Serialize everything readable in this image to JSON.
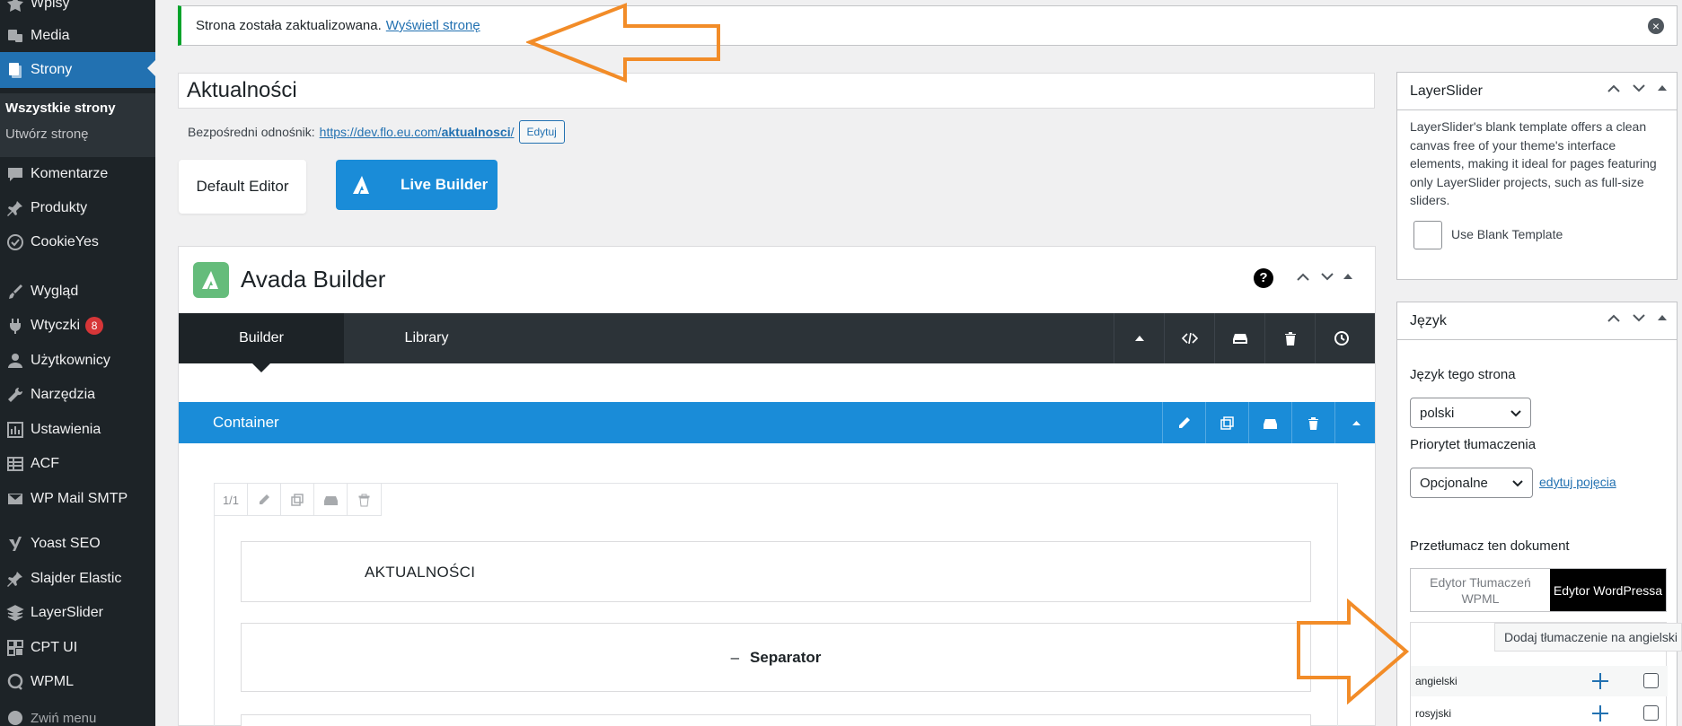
{
  "sidebar": {
    "items": [
      {
        "label": "Wpisy",
        "icon": "pin-icon"
      },
      {
        "label": "Media",
        "icon": "media-icon"
      },
      {
        "label": "Strony",
        "icon": "pages-icon"
      },
      {
        "label": "Komentarze",
        "icon": "comment-icon"
      },
      {
        "label": "Produkty",
        "icon": "pin-icon"
      },
      {
        "label": "CookieYes",
        "icon": "cookie-icon"
      },
      {
        "label": "Wygląd",
        "icon": "brush-icon"
      },
      {
        "label": "Wtyczki",
        "icon": "plugin-icon",
        "badge": "8"
      },
      {
        "label": "Użytkownicy",
        "icon": "user-icon"
      },
      {
        "label": "Narzędzia",
        "icon": "wrench-icon"
      },
      {
        "label": "Ustawienia",
        "icon": "settings-icon"
      },
      {
        "label": "ACF",
        "icon": "table-icon"
      },
      {
        "label": "WP Mail SMTP",
        "icon": "mail-icon"
      },
      {
        "label": "Yoast SEO",
        "icon": "yoast-icon"
      },
      {
        "label": "Slajder Elastic",
        "icon": "pin-icon"
      },
      {
        "label": "LayerSlider",
        "icon": "layers-icon"
      },
      {
        "label": "CPT UI",
        "icon": "grid-icon"
      },
      {
        "label": "WPML",
        "icon": "wpml-icon"
      },
      {
        "label": "Zwiń menu",
        "icon": "collapse-icon"
      }
    ],
    "submenu": [
      "Wszystkie strony",
      "Utwórz stronę"
    ]
  },
  "notice": {
    "text": "Strona została zaktualizowana.",
    "link": "Wyświetl stronę"
  },
  "editor": {
    "title": "Aktualności",
    "permalink_label": "Bezpośredni odnośnik:",
    "permalink_base": "https://dev.flo.eu.com/",
    "permalink_slug": "aktualnosci",
    "permalink_end": "/",
    "edit_label": "Edytuj",
    "default_editor": "Default Editor",
    "live_builder": "Live Builder"
  },
  "avada": {
    "title": "Avada Builder",
    "help": "?",
    "tabs": [
      "Builder",
      "Library"
    ],
    "container_label": "Container",
    "column_size": "1/1",
    "title_element": "AKTUALNOŚCI",
    "separator_label": "Separator",
    "separator_dash": "–"
  },
  "layerslider_box": {
    "title": "LayerSlider",
    "description": "LayerSlider's blank template offers a clean canvas free of your theme's interface elements, making it ideal for pages featuring only LayerSlider projects, such as full-size sliders.",
    "checkbox_label": "Use Blank Template"
  },
  "language_box": {
    "title": "Język",
    "page_lang_label": "Język tego strona",
    "page_lang_value": "polski",
    "priority_label": "Priorytet tłumaczenia",
    "priority_value": "Opcjonalne",
    "edit_terms": "edytuj pojęcia",
    "translate_label": "Przetłumacz ten dokument",
    "tab_wpml": "Edytor Tłumaczeń WPML",
    "tab_wp": "Edytor WordPressa",
    "tooltip": "Dodaj tłumaczenie na angielski",
    "languages": [
      "angielski",
      "rosyjski"
    ]
  },
  "colors": {
    "sidebar_bg": "#1d2327",
    "active_blue": "#2271b1",
    "builder_blue": "#1a8cd8",
    "avada_green": "#65bc7b",
    "annotation_orange": "#f28c28",
    "notice_green": "#00a32a"
  }
}
